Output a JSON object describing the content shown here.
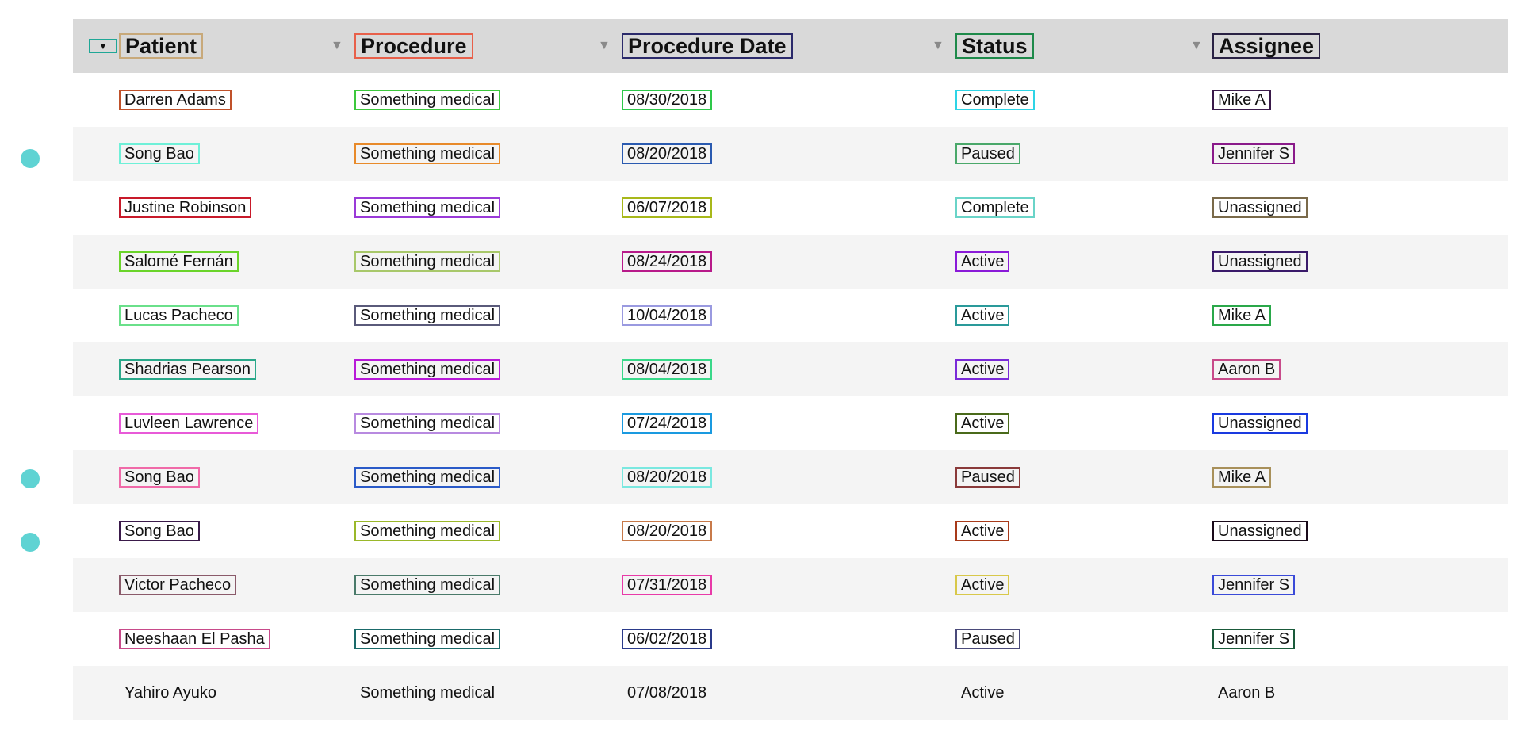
{
  "table": {
    "columns": [
      "Patient",
      "Procedure",
      "Procedure Date",
      "Status",
      "Assignee"
    ],
    "sorted_column": "Patient",
    "rows": [
      {
        "patient": "Darren Adams",
        "procedure": "Something medical",
        "date": "08/30/2018",
        "status": "Complete",
        "assignee": "Mike A",
        "selected": false
      },
      {
        "patient": "Song Bao",
        "procedure": "Something medical",
        "date": "08/20/2018",
        "status": "Paused",
        "assignee": "Jennifer S",
        "selected": true
      },
      {
        "patient": "Justine Robinson",
        "procedure": "Something medical",
        "date": "06/07/2018",
        "status": "Complete",
        "assignee": "Unassigned",
        "selected": false
      },
      {
        "patient": "Salomé Fernán",
        "procedure": "Something medical",
        "date": "08/24/2018",
        "status": "Active",
        "assignee": "Unassigned",
        "selected": false
      },
      {
        "patient": "Lucas Pacheco",
        "procedure": "Something medical",
        "date": "10/04/2018",
        "status": "Active",
        "assignee": "Mike A",
        "selected": false
      },
      {
        "patient": "Shadrias Pearson",
        "procedure": "Something medical",
        "date": "08/04/2018",
        "status": "Active",
        "assignee": "Aaron B",
        "selected": false
      },
      {
        "patient": "Luvleen Lawrence",
        "procedure": "Something medical",
        "date": "07/24/2018",
        "status": "Active",
        "assignee": "Unassigned",
        "selected": false
      },
      {
        "patient": "Song Bao",
        "procedure": "Something medical",
        "date": "08/20/2018",
        "status": "Paused",
        "assignee": "Mike A",
        "selected": true
      },
      {
        "patient": "Song Bao",
        "procedure": "Something medical",
        "date": "08/20/2018",
        "status": "Active",
        "assignee": "Unassigned",
        "selected": true
      },
      {
        "patient": "Victor Pacheco",
        "procedure": "Something medical",
        "date": "07/31/2018",
        "status": "Active",
        "assignee": "Jennifer S",
        "selected": false
      },
      {
        "patient": "Neeshaan El Pasha",
        "procedure": "Something medical",
        "date": "06/02/2018",
        "status": "Paused",
        "assignee": "Jennifer S",
        "selected": false
      },
      {
        "patient": "Yahiro Ayuko",
        "procedure": "Something medical",
        "date": "07/08/2018",
        "status": "Active",
        "assignee": "Aaron B",
        "selected": false
      }
    ]
  },
  "icons": {
    "sort_caret": "caret-down-icon",
    "row_marker": "dot-icon"
  },
  "colors": {
    "header_bg": "#d9d9d9",
    "alt_row_bg": "#f4f4f4",
    "row_marker": "#5fd3d3",
    "sort_active_border": "#1fa796"
  }
}
